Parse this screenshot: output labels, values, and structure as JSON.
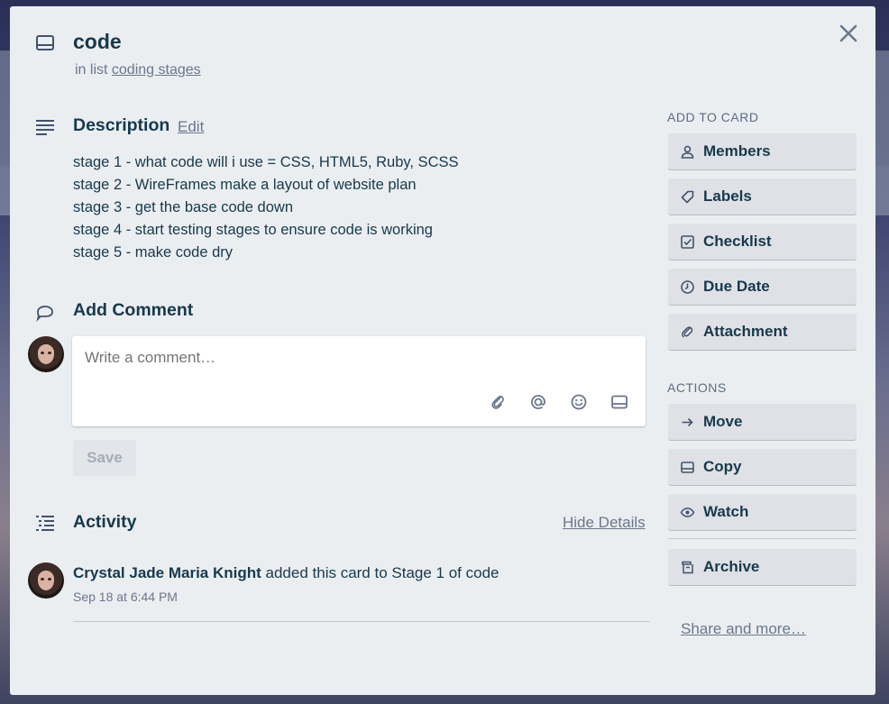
{
  "card": {
    "title": "code",
    "in_list_prefix": "in list",
    "list_name": "coding stages"
  },
  "description": {
    "heading": "Description",
    "edit_label": "Edit",
    "lines": [
      "stage 1 - what code will i use = CSS, HTML5, Ruby, SCSS",
      "stage 2 - WireFrames make a layout of website plan",
      "stage 3 - get the base code down",
      "stage 4 - start testing stages to ensure code is working",
      "stage 5 - make code dry"
    ]
  },
  "comment": {
    "heading": "Add Comment",
    "placeholder": "Write a comment…",
    "save_label": "Save"
  },
  "activity": {
    "heading": "Activity",
    "hide_details_label": "Hide Details",
    "entries": [
      {
        "user": "Crystal Jade Maria Knight",
        "action": "added this card to Stage 1 of code",
        "time": "Sep 18 at 6:44 PM"
      }
    ]
  },
  "sidebar": {
    "add_to_card_title": "ADD TO CARD",
    "add_buttons": [
      {
        "label": "Members",
        "icon": "person-icon"
      },
      {
        "label": "Labels",
        "icon": "tag-icon"
      },
      {
        "label": "Checklist",
        "icon": "checkbox-icon"
      },
      {
        "label": "Due Date",
        "icon": "clock-icon"
      },
      {
        "label": "Attachment",
        "icon": "paperclip-icon"
      }
    ],
    "actions_title": "ACTIONS",
    "action_buttons": [
      {
        "label": "Move",
        "icon": "arrow-right-icon"
      },
      {
        "label": "Copy",
        "icon": "card-icon"
      },
      {
        "label": "Watch",
        "icon": "eye-icon"
      },
      {
        "label": "Archive",
        "icon": "archive-icon"
      }
    ],
    "share_label": "Share and more…"
  },
  "colors": {
    "window_bg": "#ebeef0",
    "heading_text": "#17394d",
    "muted_text": "#6b778c",
    "button_bg": "#dfe1e6"
  }
}
